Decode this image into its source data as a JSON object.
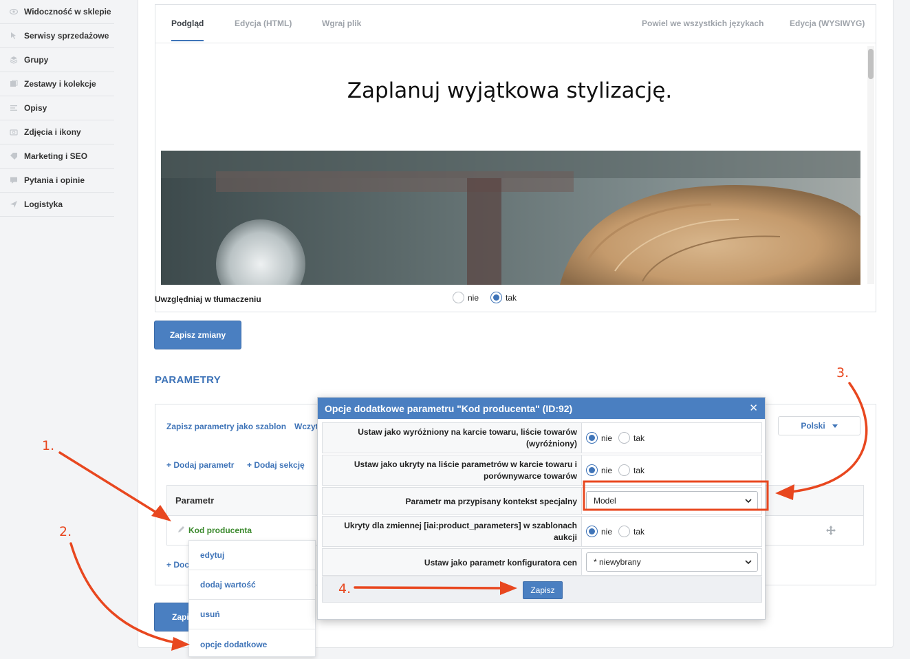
{
  "sidebar": {
    "items": [
      {
        "label": "Widoczność w sklepie",
        "icon": "eye-icon"
      },
      {
        "label": "Serwisy sprzedażowe",
        "icon": "pointer-icon"
      },
      {
        "label": "Grupy",
        "icon": "layers-icon"
      },
      {
        "label": "Zestawy i kolekcje",
        "icon": "collection-icon"
      },
      {
        "label": "Opisy",
        "icon": "text-lines-icon"
      },
      {
        "label": "Zdjęcia i ikony",
        "icon": "camera-icon"
      },
      {
        "label": "Marketing i SEO",
        "icon": "tag-icon"
      },
      {
        "label": "Pytania i opinie",
        "icon": "comment-icon"
      },
      {
        "label": "Logistyka",
        "icon": "send-icon"
      }
    ]
  },
  "editor": {
    "tabs": [
      "Podgląd",
      "Edycja (HTML)",
      "Wgraj plik",
      "Powiel we wszystkich językach",
      "Edycja (WYSIWYG)"
    ],
    "active_tab": "Podgląd",
    "preview_heading": "Zaplanuj wyjątkowa stylizację."
  },
  "translation": {
    "label": "Uwzględniaj w tłumaczeniu",
    "no": "nie",
    "yes": "tak",
    "selected": "tak"
  },
  "save_changes": "Zapisz zmiany",
  "save_partial": "Zapi",
  "params": {
    "title": "PARAMETRY",
    "save_template": "Zapisz parametry jako szablon",
    "load_partial": "Wczyt",
    "add_param": "Dodaj parametr",
    "add_section": "Dodaj sekcję",
    "add_partial": "Doc",
    "add_partial2": "Doc",
    "language": "Polski",
    "column_header": "Parametr",
    "row_name": "Kod producenta"
  },
  "context_menu": {
    "items": [
      "edytuj",
      "dodaj wartość",
      "usuń",
      "opcje dodatkowe"
    ]
  },
  "modal": {
    "title": "Opcje dodatkowe parametru \"Kod producenta\" (ID:92)",
    "rows": [
      {
        "label": "Ustaw jako wyróżniony na karcie towaru, liście towarów (wyróżniony)",
        "no": "nie",
        "yes": "tak"
      },
      {
        "label": "Ustaw jako ukryty na liście parametrów w karcie towaru i porównywarce towarów",
        "no": "nie",
        "yes": "tak"
      },
      {
        "label": "Parametr ma przypisany kontekst specjalny",
        "select_value": "Model"
      },
      {
        "label": "Ukryty dla zmiennej [iai:product_parameters] w szablonach aukcji",
        "no": "nie",
        "yes": "tak"
      },
      {
        "label": "Ustaw jako parametr konfiguratora cen",
        "select_value": "* niewybrany"
      }
    ],
    "save": "Zapisz"
  },
  "annotations": [
    "1.",
    "2.",
    "3.",
    "4."
  ],
  "colors": {
    "accent": "#4a7fc1",
    "annotation": "#e8471f",
    "param_green": "#3c8a2e"
  }
}
